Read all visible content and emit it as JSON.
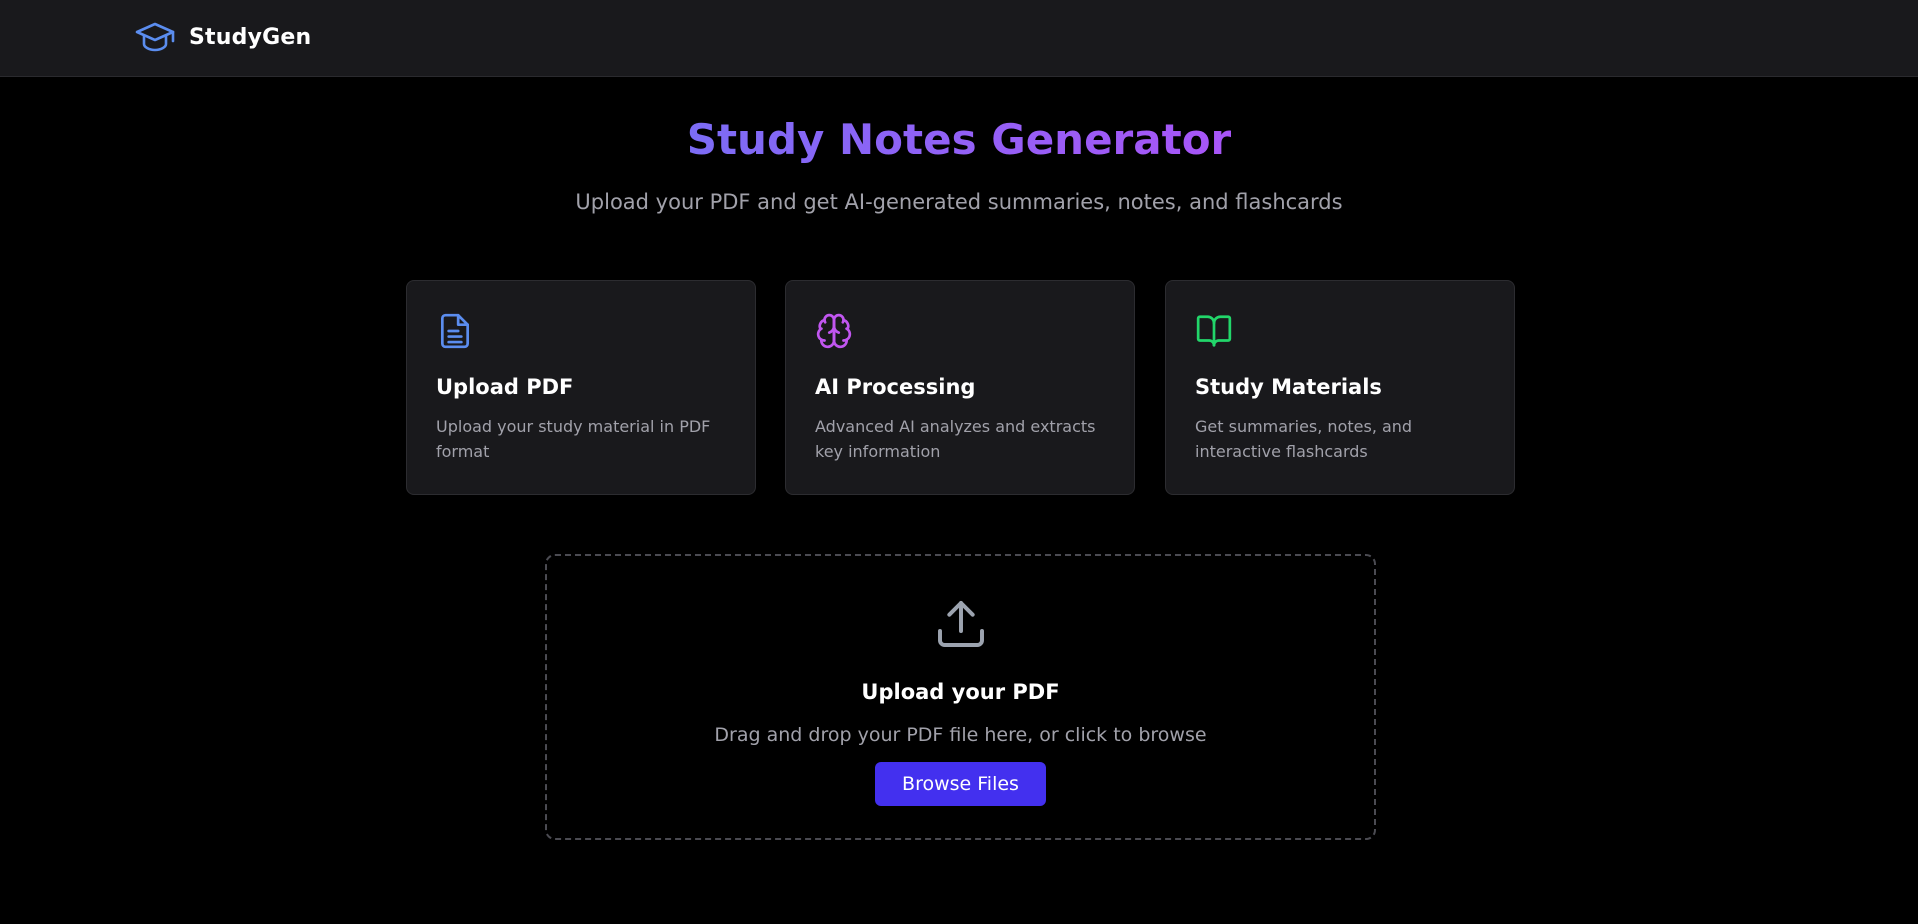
{
  "header": {
    "brand_name": "StudyGen",
    "brand_icon": "graduation-cap-icon"
  },
  "hero": {
    "title": "Study Notes Generator",
    "subtitle": "Upload your PDF and get AI-generated summaries, notes, and flashcards"
  },
  "features": [
    {
      "icon": "file-text-icon",
      "icon_color": "#5b8def",
      "title": "Upload PDF",
      "description": "Upload your study material in PDF format"
    },
    {
      "icon": "brain-icon",
      "icon_color": "#c156f0",
      "title": "AI Processing",
      "description": "Advanced AI analyzes and extracts key information"
    },
    {
      "icon": "book-open-icon",
      "icon_color": "#22d66a",
      "title": "Study Materials",
      "description": "Get summaries, notes, and interactive flashcards"
    }
  ],
  "upload": {
    "icon": "upload-icon",
    "title": "Upload your PDF",
    "subtitle": "Drag and drop your PDF file here, or click to browse",
    "button_label": "Browse Files"
  },
  "colors": {
    "background": "#000000",
    "surface": "#19191c",
    "accent_button": "#4330ef",
    "title_gradient_start": "#7c6cf5",
    "title_gradient_end": "#a855f7",
    "muted_text": "#a1a1aa"
  }
}
